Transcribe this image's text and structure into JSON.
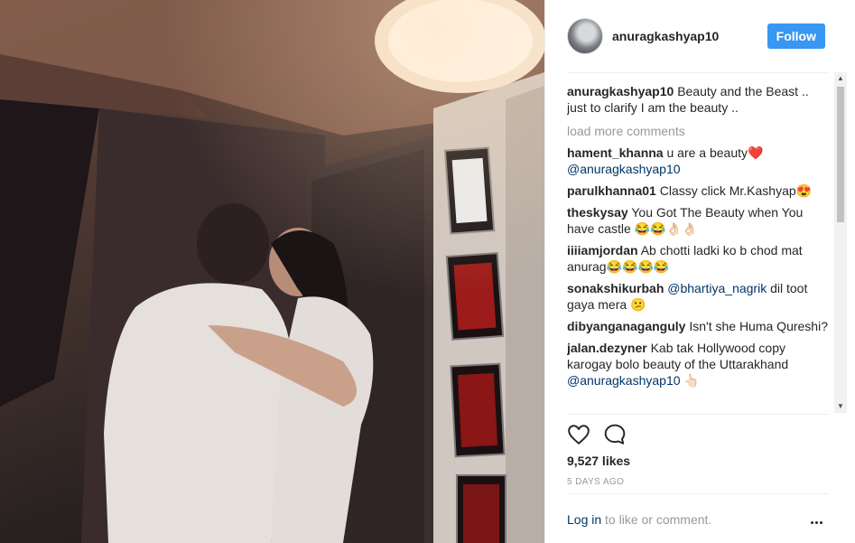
{
  "post": {
    "username": "anuragkashyap10",
    "follow_label": "Follow",
    "caption_user": "anuragkashyap10",
    "caption_text": "Beauty and the Beast .. just to clarify I am the beauty ..",
    "load_more": "load more comments",
    "comments": [
      {
        "user": "hament_khanna",
        "pre": "u are a beauty❤️",
        "mention": "@anuragkashyap10",
        "post": ""
      },
      {
        "user": "parulkhanna01",
        "pre": "Classy click Mr.Kashyap😍",
        "mention": "",
        "post": ""
      },
      {
        "user": "theskysay",
        "pre": "You Got The Beauty when You have castle 😂😂👌🏻👌🏻",
        "mention": "",
        "post": ""
      },
      {
        "user": "iiiiamjordan",
        "pre": "Ab chotti ladki ko b chod mat anurag😂😂😂😂",
        "mention": "",
        "post": ""
      },
      {
        "user": "sonakshikurbah",
        "pre": "",
        "mention": "@bhartiya_nagrik",
        "post": " dil toot gaya mera 😕"
      },
      {
        "user": "dibyanganaganguly",
        "pre": "Isn't she Huma Qureshi?",
        "mention": "",
        "post": ""
      },
      {
        "user": "jalan.dezyner",
        "pre": "Kab tak Hollywood copy karogay bolo beauty of the Uttarakhand",
        "mention": "@anuragkashyap10",
        "post": " 👆🏻"
      }
    ],
    "likes": "9,527 likes",
    "time_ago": "5 DAYS AGO",
    "footer_login": "Log in",
    "footer_rest": " to like or comment."
  },
  "icons": {
    "like": "heart-icon",
    "comment": "speech-bubble-icon",
    "more": "more-options-icon"
  },
  "colors": {
    "follow_button": "#3897f0",
    "mention": "#003569",
    "muted": "#999999"
  }
}
